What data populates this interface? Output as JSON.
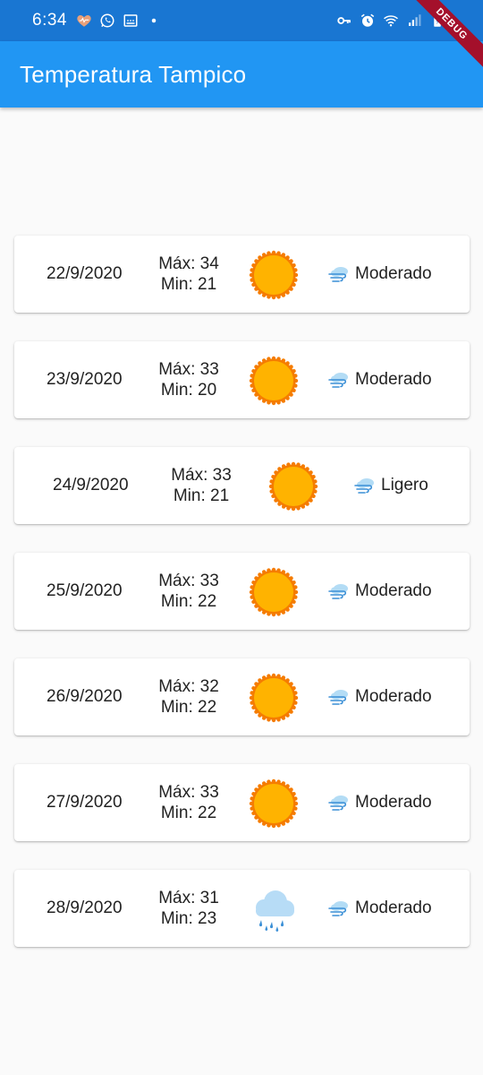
{
  "status_bar": {
    "time": "6:34",
    "icons_left": [
      "heart-icon",
      "whatsapp-icon",
      "gallery-icon",
      "dot-icon"
    ],
    "icons_right": [
      "key-icon",
      "alarm-icon",
      "wifi-icon",
      "signal-icon",
      "battery-icon"
    ]
  },
  "debug_banner": "DEBUG",
  "app_bar": {
    "title": "Temperatura Tampico"
  },
  "colors": {
    "primary": "#2196f3",
    "status_bar": "#1976d2",
    "sun": "#ffb300",
    "sun_edge": "#f57c00"
  },
  "forecast": [
    {
      "date": "22/9/2020",
      "max": "Máx: 34",
      "min": "Min: 21",
      "weather_icon": "sun-icon",
      "wind": "Moderado"
    },
    {
      "date": "23/9/2020",
      "max": "Máx: 33",
      "min": "Min: 20",
      "weather_icon": "sun-icon",
      "wind": "Moderado"
    },
    {
      "date": "24/9/2020",
      "max": "Máx: 33",
      "min": "Min: 21",
      "weather_icon": "sun-icon",
      "wind": "Ligero"
    },
    {
      "date": "25/9/2020",
      "max": "Máx: 33",
      "min": "Min: 22",
      "weather_icon": "sun-icon",
      "wind": "Moderado"
    },
    {
      "date": "26/9/2020",
      "max": "Máx: 32",
      "min": "Min: 22",
      "weather_icon": "sun-icon",
      "wind": "Moderado"
    },
    {
      "date": "27/9/2020",
      "max": "Máx: 33",
      "min": "Min: 22",
      "weather_icon": "sun-icon",
      "wind": "Moderado"
    },
    {
      "date": "28/9/2020",
      "max": "Máx: 31",
      "min": "Min: 23",
      "weather_icon": "rain-cloud-icon",
      "wind": "Moderado"
    }
  ]
}
